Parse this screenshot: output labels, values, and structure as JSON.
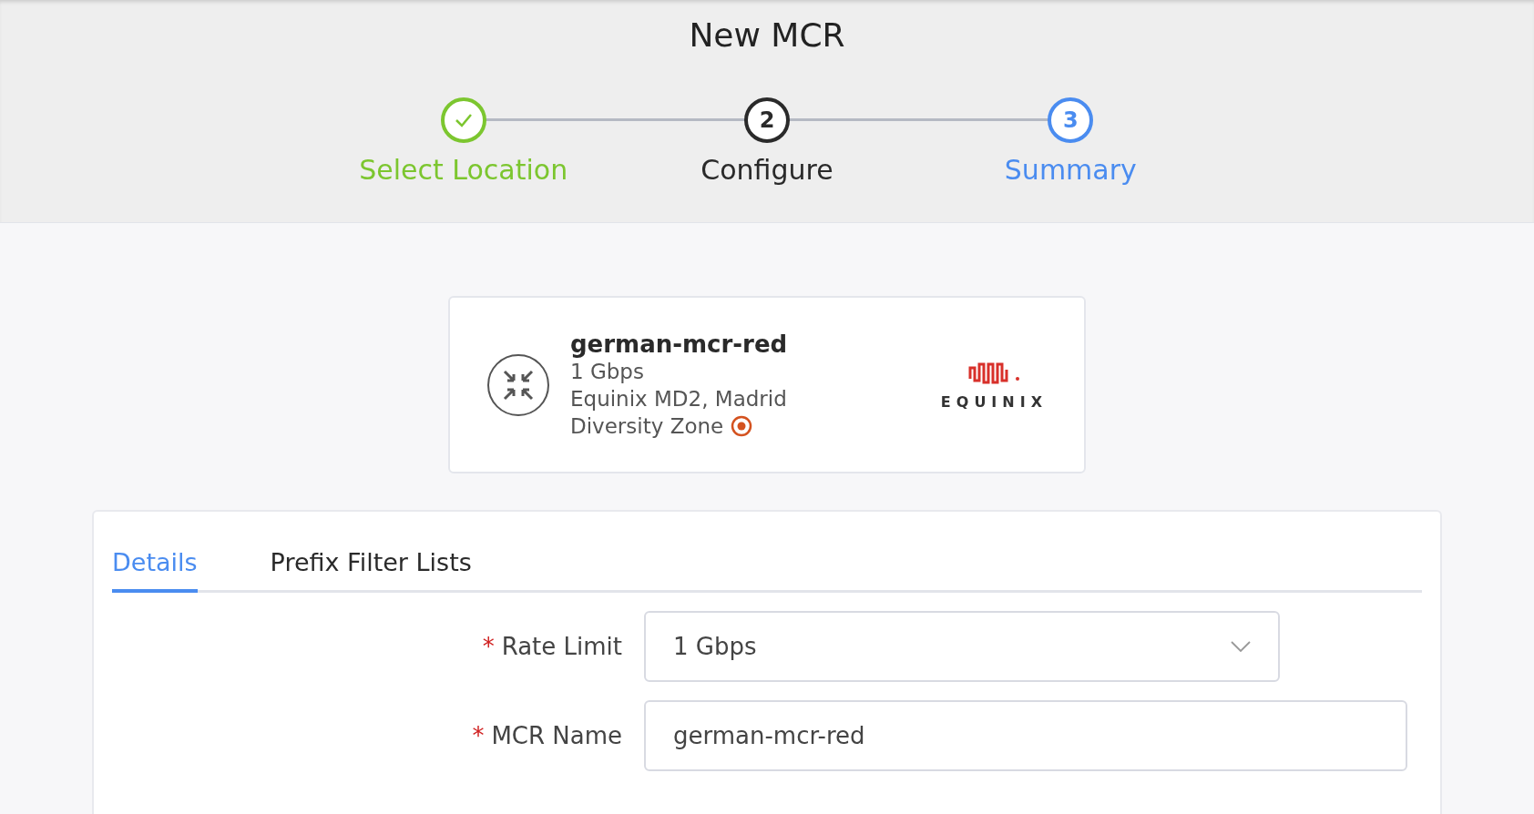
{
  "title": "New MCR",
  "steps": [
    {
      "label": "Select Location",
      "kind": "done"
    },
    {
      "label": "Configure",
      "kind": "current",
      "marker": "2"
    },
    {
      "label": "Summary",
      "kind": "upcoming",
      "marker": "3"
    }
  ],
  "port_card": {
    "name": "german-mcr-red",
    "speed": "1 Gbps",
    "location": "Equinix MD2, Madrid",
    "zone": {
      "label": "Diversity Zone",
      "color": "#d4521f"
    },
    "logo_text": "EQUINIX"
  },
  "tabs": [
    {
      "label": "Details",
      "selected": true
    },
    {
      "label": "Prefix Filter Lists",
      "selected": false
    }
  ],
  "fields": [
    {
      "kind": "select",
      "label": "Rate Limit",
      "required_mark": "*",
      "value": "1 Gbps"
    },
    {
      "kind": "text",
      "label": "MCR Name",
      "required_mark": "*",
      "value": "german-mcr-red"
    }
  ]
}
